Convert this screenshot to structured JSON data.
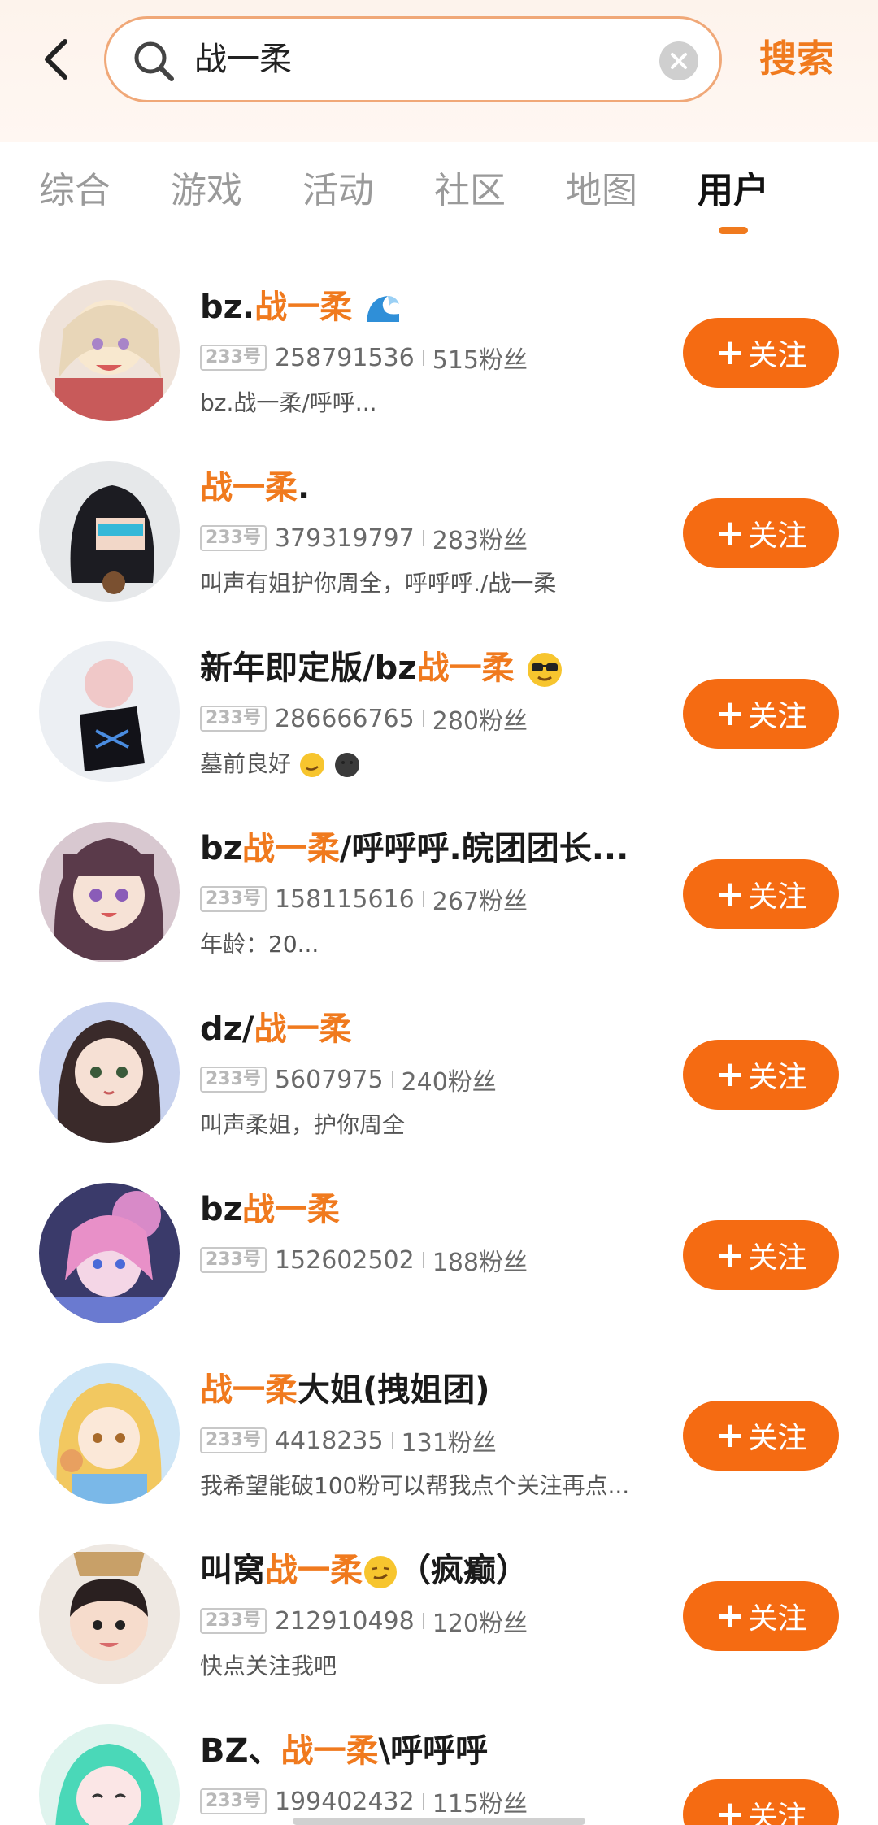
{
  "header": {
    "search_value": "战一柔",
    "search_button": "搜索"
  },
  "tabs": [
    {
      "label": "综合",
      "active": false
    },
    {
      "label": "游戏",
      "active": false
    },
    {
      "label": "活动",
      "active": false
    },
    {
      "label": "社区",
      "active": false
    },
    {
      "label": "地图",
      "active": false
    },
    {
      "label": "用户",
      "active": true
    }
  ],
  "follow_label": "关注",
  "badge_label": "233号",
  "users": [
    {
      "name_pre": "bz.",
      "name_hl": "战一柔",
      "name_post": "",
      "emoji": "wave",
      "id": "258791536",
      "fans": "515粉丝",
      "desc": "bz.战一柔/呼呼..."
    },
    {
      "name_pre": "",
      "name_hl": "战一柔",
      "name_post": ".",
      "emoji": "",
      "id": "379319797",
      "fans": "283粉丝",
      "desc": "叫声有姐护你周全，呼呼呼./战一柔"
    },
    {
      "name_pre": "新年即定版/bz",
      "name_hl": "战一柔",
      "name_post": "",
      "emoji": "sunglasses",
      "id": "286666765",
      "fans": "280粉丝",
      "desc": "墓前良好"
    },
    {
      "name_pre": "bz",
      "name_hl": "战一柔",
      "name_post": "/呼呼呼.皖团团长...",
      "emoji": "",
      "id": "158115616",
      "fans": "267粉丝",
      "desc": "年龄：20..."
    },
    {
      "name_pre": "dz/",
      "name_hl": "战一柔",
      "name_post": "",
      "emoji": "",
      "id": "5607975",
      "fans": "240粉丝",
      "desc": "叫声柔姐，护你周全"
    },
    {
      "name_pre": "bz",
      "name_hl": "战一柔",
      "name_post": "",
      "emoji": "",
      "id": "152602502",
      "fans": "188粉丝",
      "desc": ""
    },
    {
      "name_pre": "",
      "name_hl": "战一柔",
      "name_post": "大姐(拽姐团)",
      "emoji": "",
      "id": "4418235",
      "fans": "131粉丝",
      "desc": "我希望能破100粉可以帮我点个关注再点..."
    },
    {
      "name_pre": "叫窝",
      "name_hl": "战一柔",
      "name_post": "（疯癫）",
      "emoji": "smirk",
      "id": "212910498",
      "fans": "120粉丝",
      "desc": "快点关注我吧"
    },
    {
      "name_pre": "BZ、",
      "name_hl": "战一柔",
      "name_post": "\\呼呼呼",
      "emoji": "",
      "id": "199402432",
      "fans": "115粉丝",
      "desc": ""
    }
  ]
}
